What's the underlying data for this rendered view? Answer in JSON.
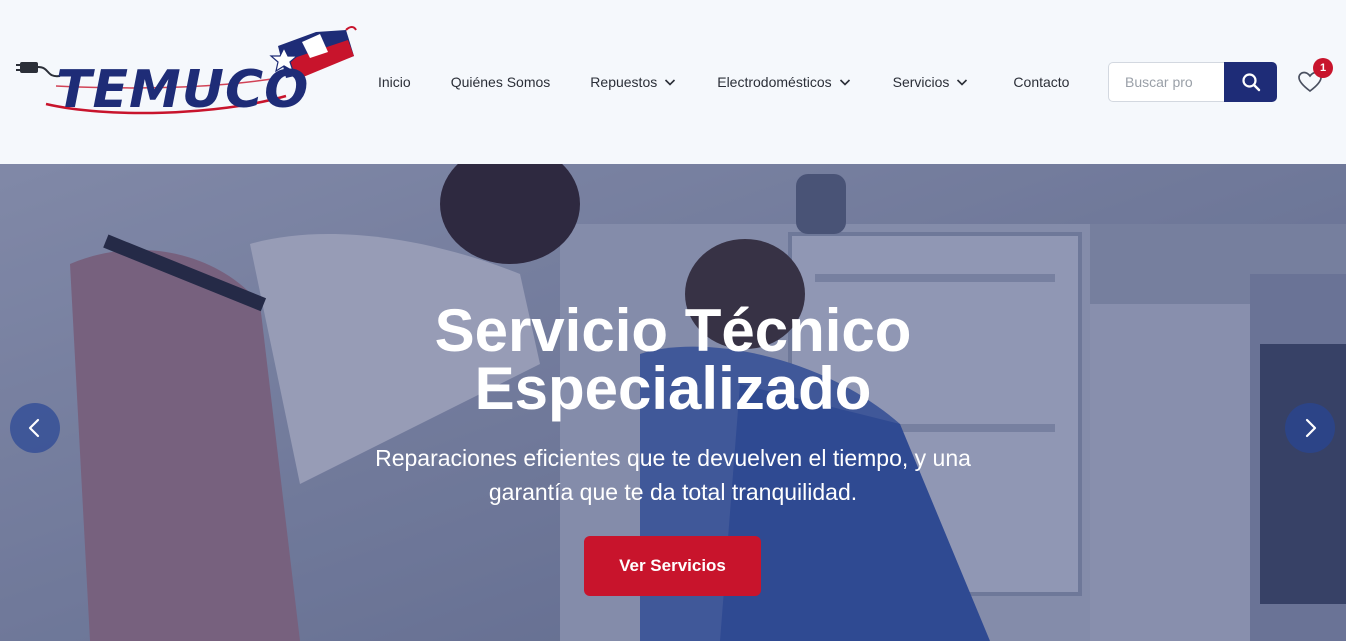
{
  "brand": {
    "logo_text": "TEMUCO"
  },
  "nav": {
    "items": [
      {
        "label": "Inicio"
      },
      {
        "label": "Quiénes Somos"
      },
      {
        "label": "Repuestos"
      },
      {
        "label": "Electrodomésticos"
      },
      {
        "label": "Servicios"
      },
      {
        "label": "Contacto"
      }
    ]
  },
  "search": {
    "placeholder": "Buscar pro",
    "icon": "search-icon"
  },
  "wishlist": {
    "icon": "heart-icon",
    "count": "1"
  },
  "hero": {
    "title_line1": "Servicio Técnico",
    "title_line2": "Especializado",
    "subtitle_line1": "Reparaciones eficientes que te devuelven el tiempo, y una",
    "subtitle_line2": "garantía que te da total tranquilidad.",
    "cta_label": "Ver Servicios",
    "prev_icon": "chevron-left-icon",
    "next_icon": "chevron-right-icon"
  },
  "colors": {
    "brand_navy": "#1e2c77",
    "brand_red": "#c8142c",
    "header_bg": "#f5f8fc"
  }
}
